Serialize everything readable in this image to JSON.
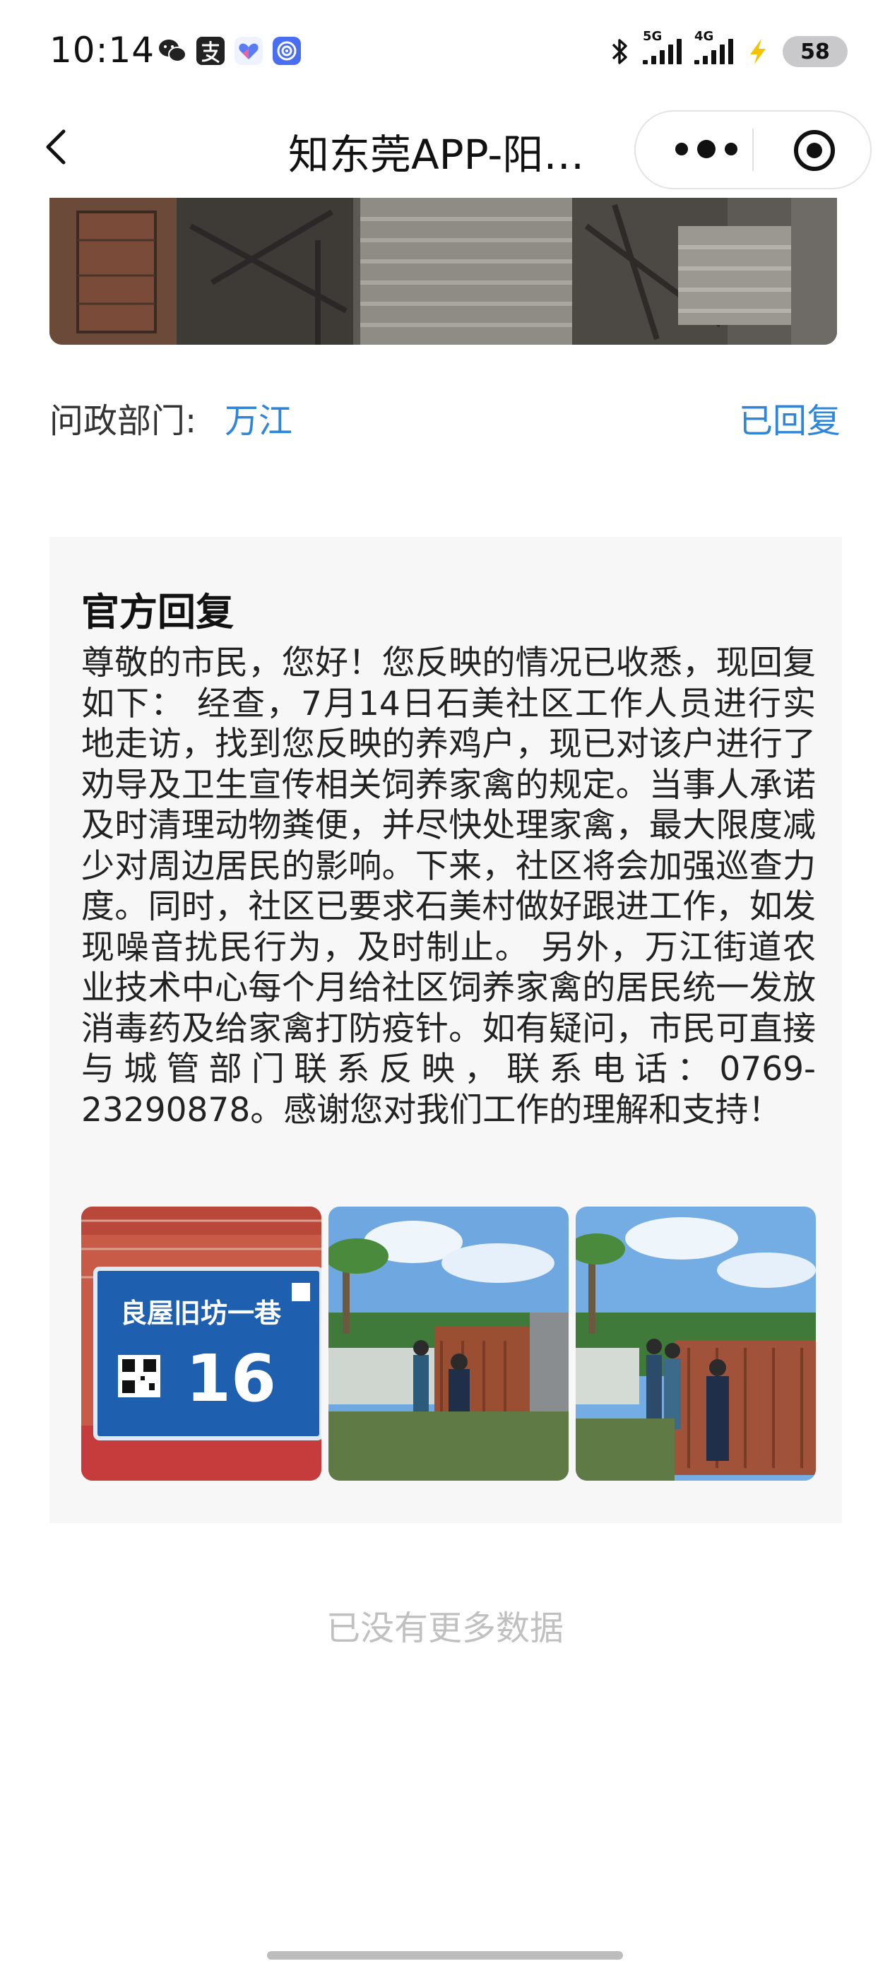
{
  "status_bar": {
    "time": "10:14",
    "net1": "5G",
    "net2": "4G",
    "battery": "58"
  },
  "nav": {
    "title": "知东莞APP-阳…"
  },
  "department": {
    "label": "问政部门:",
    "value": "万江",
    "status": "已回复"
  },
  "reply": {
    "title": "官方回复",
    "body": "尊敬的市民，您好！您反映的情况已收悉，现回复如下： 经查，7月14日石美社区工作人员进行实地走访，找到您反映的养鸡户，现已对该户进行了劝导及卫生宣传相关饲养家禽的规定。当事人承诺及时清理动物粪便，并尽快处理家禽，最大限度减少对周边居民的影响。下来，社区将会加强巡查力度。同时，社区已要求石美村做好跟进工作，如发现噪音扰民行为，及时制止。 另外，万江街道农业技术中心每个月给社区饲养家禽的居民统一发放消毒药及给家禽打防疫针。如有疑问，市民可直接与城管部门联系反映，联系电话：0769-23290878。感谢您对我们工作的理解和支持！",
    "photo1_sign_line1": "良屋旧坊一巷",
    "photo1_sign_line2": "16"
  },
  "footer": {
    "no_more": "已没有更多数据"
  },
  "colors": {
    "accent_blue": "#2f86d6",
    "card_bg": "#f7f7f7"
  },
  "icons": {
    "back": "chevron-left-icon",
    "more": "more-dots-icon",
    "close": "target-circle-icon"
  }
}
